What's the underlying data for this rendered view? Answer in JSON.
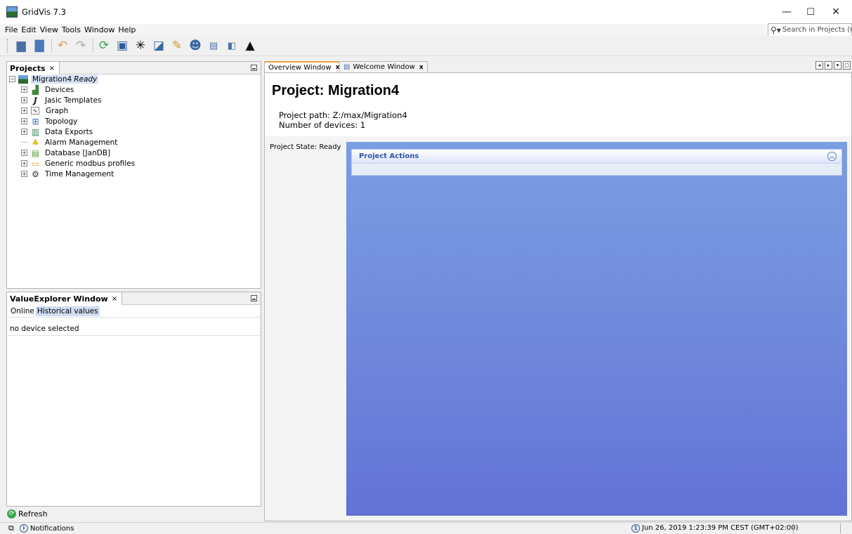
{
  "window": {
    "title": "GridVis 7.3",
    "minimize_glyph": "—",
    "maximize_glyph": "☐",
    "close_glyph": "✕"
  },
  "menu": [
    "File",
    "Edit",
    "View",
    "Tools",
    "Window",
    "Help"
  ],
  "search": {
    "placeholder": "Search in Projects (Ctrl+I)"
  },
  "toolbar": {
    "icons": [
      "new-project-icon",
      "open-project-icon",
      "undo-icon",
      "redo-icon",
      "sync-icon",
      "device-icon",
      "topology-icon",
      "export-icon",
      "wizard-icon",
      "user-icon",
      "screen-icon",
      "device-list-icon",
      "academy-icon"
    ]
  },
  "projects_panel": {
    "tab_label": "Projects",
    "close": "×",
    "root": {
      "name": "Migration4",
      "status": "Ready"
    },
    "items": [
      {
        "label": "Devices",
        "icon": "devices-icon"
      },
      {
        "label": "Jasic Templates",
        "icon": "jasic-icon"
      },
      {
        "label": "Graph",
        "icon": "graph-icon"
      },
      {
        "label": "Topology",
        "icon": "topology-icon"
      },
      {
        "label": "Data Exports",
        "icon": "data-export-icon"
      },
      {
        "label": "Alarm Management",
        "icon": "alarm-icon"
      },
      {
        "label": "Database [JanDB]",
        "icon": "database-icon"
      },
      {
        "label": "Generic modbus profiles",
        "icon": "folder-icon"
      },
      {
        "label": "Time Management",
        "icon": "time-icon"
      }
    ]
  },
  "value_explorer": {
    "tab_label": "ValueExplorer Window",
    "close": "×",
    "tabs": [
      "Online",
      "Historical values"
    ],
    "message": "no device selected",
    "refresh_label": "Refresh"
  },
  "editor": {
    "tabs": [
      {
        "label": "Overview Window",
        "close": "x"
      },
      {
        "label": "Welcome Window",
        "close": "x"
      }
    ],
    "project_title": "Project: Migration4",
    "project_path": "Project path: Z:/max/Migration4",
    "device_count": "Number of devices: 1",
    "project_state": "Project State: Ready",
    "actions_title": "Project Actions"
  },
  "statusbar": {
    "notifications_label": "Notifications",
    "timestamp": "Jun 26, 2019 1:23:39 PM CEST (GMT+02:00)"
  },
  "colors": {
    "accent": "#2e55a8",
    "actions_top": "#7a9ee2",
    "actions_bottom": "#6272d6",
    "tab_active": "#f0a040"
  }
}
